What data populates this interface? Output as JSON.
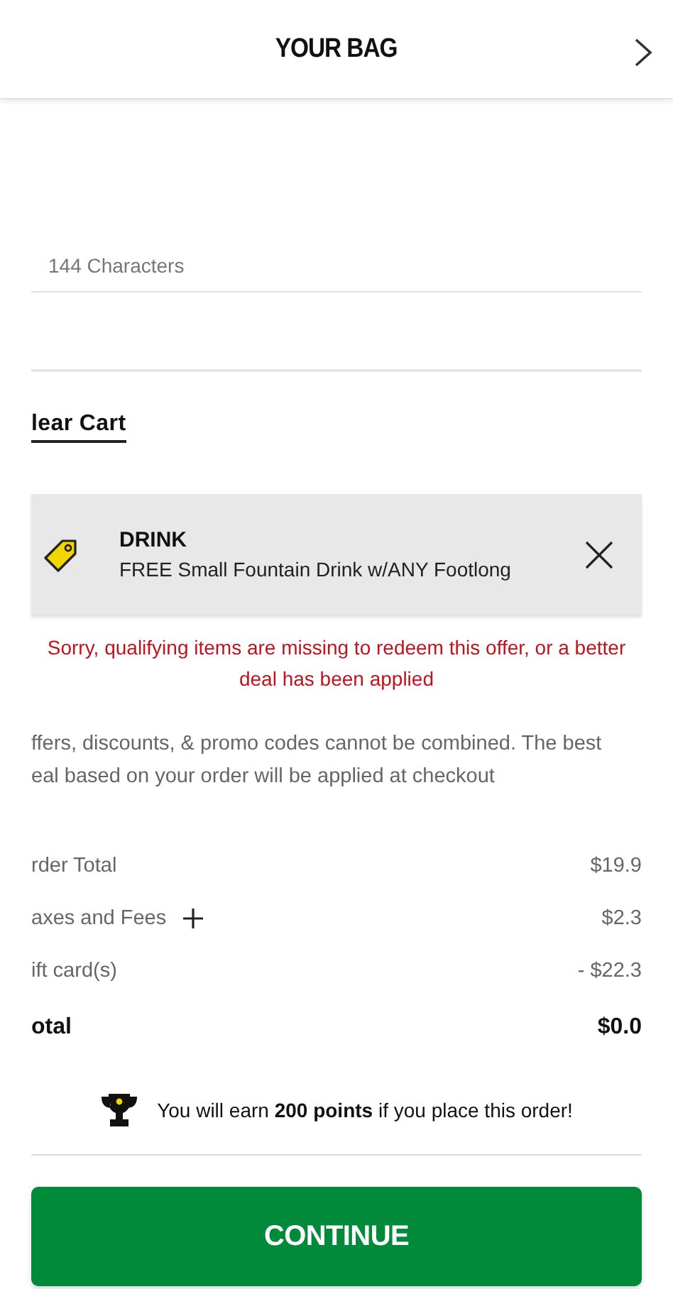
{
  "header": {
    "title": "YOUR BAG"
  },
  "note_field": {
    "counter": "144 Characters"
  },
  "clear_cart": "lear Cart",
  "offer": {
    "title": "DRINK",
    "description": "FREE Small Fountain Drink w/ANY Footlong",
    "error": "Sorry, qualifying items are missing to redeem this offer, or a better deal has been applied"
  },
  "disclaimer": [
    "ffers, discounts, & promo codes cannot be combined. The best",
    "eal based on your order will be applied at checkout"
  ],
  "summary": [
    {
      "kind": "line",
      "label": "rder Total",
      "value": "$19.9"
    },
    {
      "kind": "expandable",
      "label": "axes and Fees",
      "value": "$2.3"
    },
    {
      "kind": "line",
      "label": "ift card(s)",
      "value": "- $22.3"
    },
    {
      "kind": "total",
      "label": "otal",
      "value": "$0.0"
    }
  ],
  "rewards": "You will earn **200 points** if you place this order!",
  "continue_button": "CONTINUE"
}
